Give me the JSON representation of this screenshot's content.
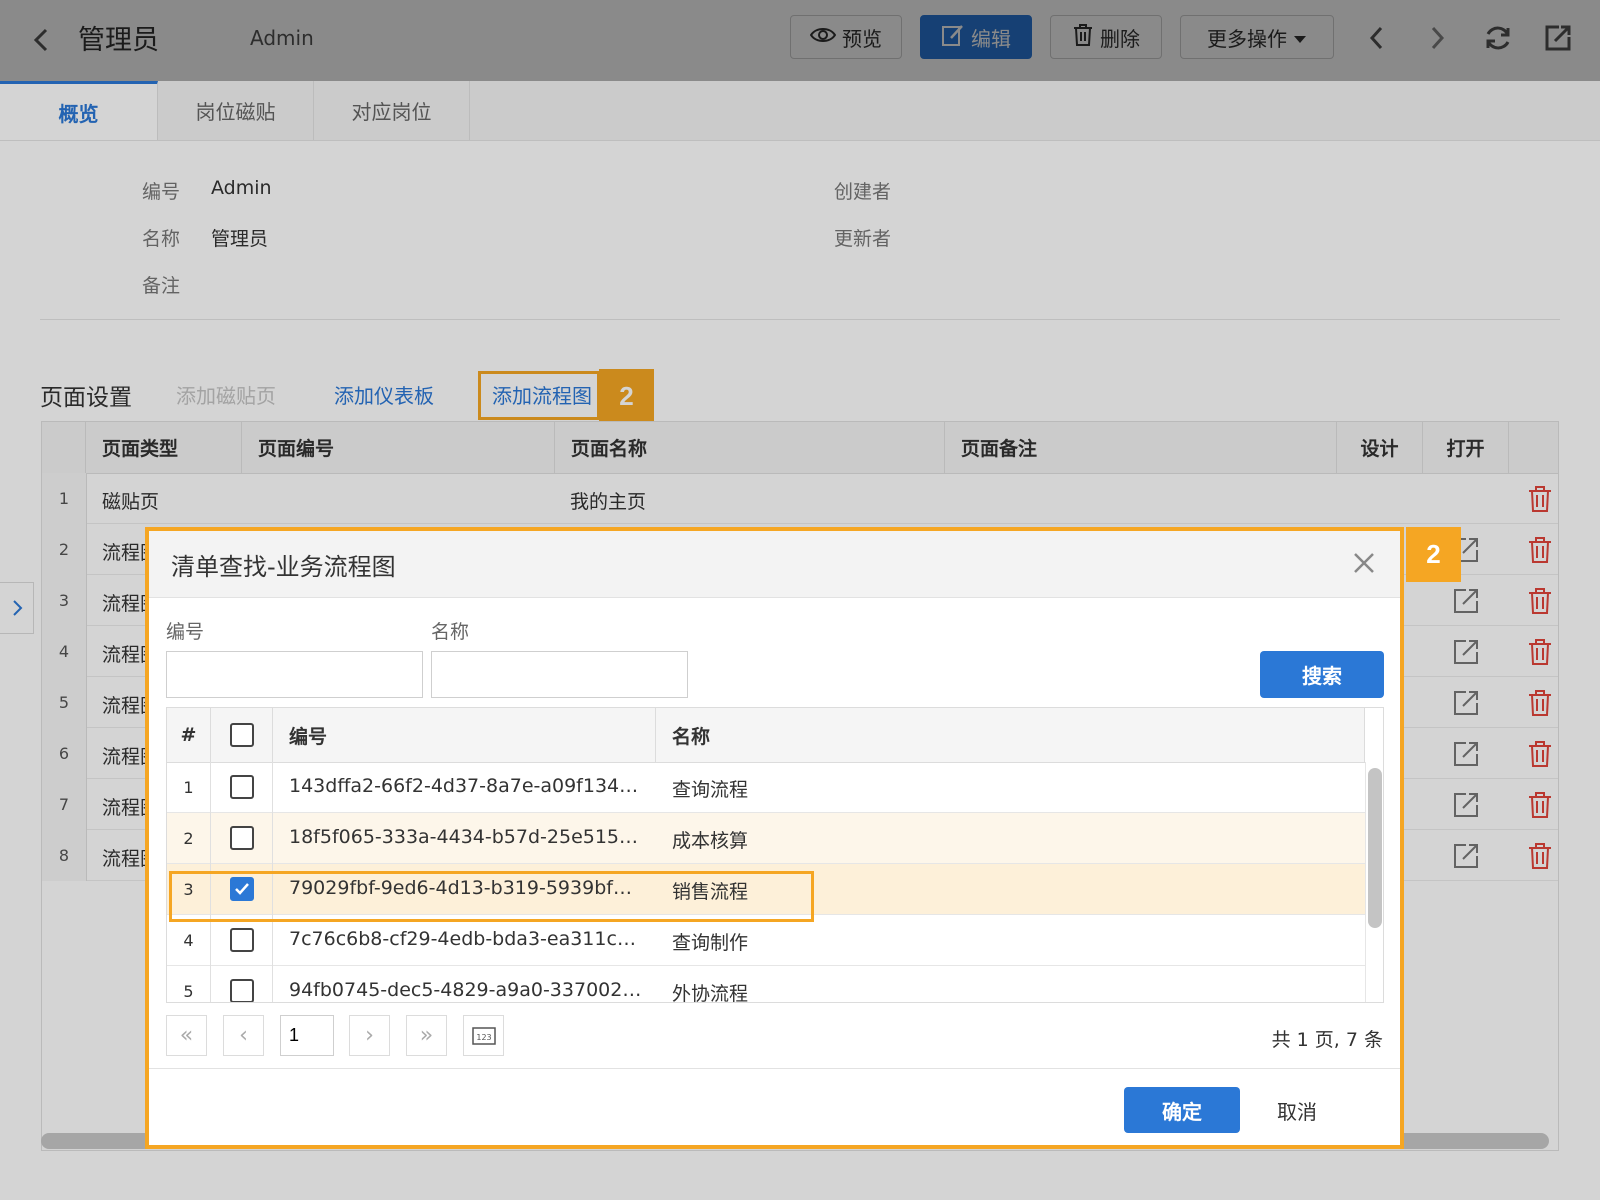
{
  "header": {
    "title": "管理员",
    "subtitle": "Admin",
    "buttons": {
      "preview": "预览",
      "edit": "编辑",
      "delete": "删除",
      "more": "更多操作"
    }
  },
  "tabs": [
    {
      "label": "概览"
    },
    {
      "label": "岗位磁贴"
    },
    {
      "label": "对应岗位"
    }
  ],
  "info": {
    "code_label": "编号",
    "code_value": "Admin",
    "name_label": "名称",
    "name_value": "管理员",
    "remark_label": "备注",
    "creator_label": "创建者",
    "updater_label": "更新者"
  },
  "page_settings": {
    "title": "页面设置",
    "add_tile": "添加磁贴页",
    "add_dashboard": "添加仪表板",
    "add_flow": "添加流程图",
    "badge": "2",
    "columns": [
      "页面类型",
      "页面编号",
      "页面名称",
      "页面备注",
      "设计",
      "打开"
    ],
    "rows": [
      {
        "idx": "1",
        "type": "磁贴页",
        "name": "我的主页"
      },
      {
        "idx": "2",
        "type": "流程图",
        "name": ""
      },
      {
        "idx": "3",
        "type": "流程图",
        "name": ""
      },
      {
        "idx": "4",
        "type": "流程图",
        "name": ""
      },
      {
        "idx": "5",
        "type": "流程图",
        "name": ""
      },
      {
        "idx": "6",
        "type": "流程图",
        "name": ""
      },
      {
        "idx": "7",
        "type": "流程图",
        "name": ""
      },
      {
        "idx": "8",
        "type": "流程图",
        "name": ""
      }
    ]
  },
  "dialog": {
    "title": "清单查找-业务流程图",
    "badge": "2",
    "code_label": "编号",
    "name_label": "名称",
    "code_value": "",
    "name_value": "",
    "search_button": "搜索",
    "columns": {
      "index": "#",
      "code": "编号",
      "name": "名称"
    },
    "rows": [
      {
        "idx": "1",
        "code": "143dffa2-66f2-4d37-8a7e-a09f134b5f…",
        "name": "查询流程",
        "checked": false
      },
      {
        "idx": "2",
        "code": "18f5f065-333a-4434-b57d-25e515ec…",
        "name": "成本核算",
        "checked": false
      },
      {
        "idx": "3",
        "code": "79029fbf-9ed6-4d13-b319-5939bf3de…",
        "name": "销售流程",
        "checked": true
      },
      {
        "idx": "4",
        "code": "7c76c6b8-cf29-4edb-bda3-ea311c2a…",
        "name": "查询制作",
        "checked": false
      },
      {
        "idx": "5",
        "code": "94fb0745-dec5-4829-a9a0-33700289…",
        "name": "外协流程",
        "checked": false
      }
    ],
    "pager": {
      "page": "1",
      "total_text": "共 1 页, 7 条",
      "page_size_icon": "123"
    },
    "confirm_button": "确定",
    "cancel_button": "取消"
  },
  "colors": {
    "accent": "#2b78d6",
    "highlight": "#f5a623",
    "delete": "#e0443a"
  }
}
